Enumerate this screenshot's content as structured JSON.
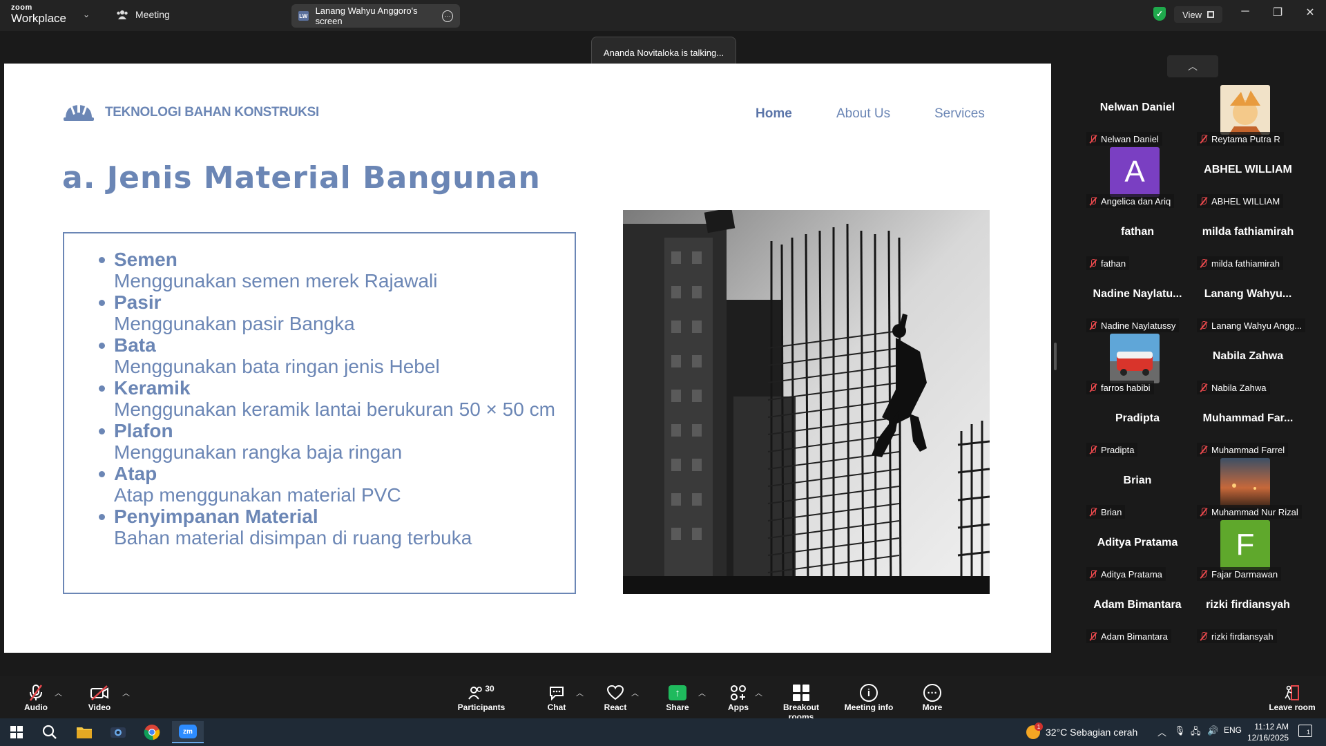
{
  "titlebar": {
    "logo_top": "zoom",
    "logo_bottom": "Workplace",
    "meeting_tab": "Meeting",
    "share_tab": "Lanang Wahyu Anggoro's screen",
    "share_badge": "LW",
    "view_label": "View"
  },
  "toast": {
    "text": "Ananda Novitaloka is talking..."
  },
  "slide": {
    "brand": "TEKNOLOGI BAHAN KONSTRUKSI",
    "nav": [
      "Home",
      "About Us",
      "Services"
    ],
    "title": "a. Jenis Material Bangunan",
    "items": [
      {
        "head": "Semen",
        "desc": "Menggunakan semen merek Rajawali"
      },
      {
        "head": "Pasir",
        "desc": "Menggunakan pasir Bangka"
      },
      {
        "head": "Bata",
        "desc": "Menggunakan bata ringan jenis Hebel"
      },
      {
        "head": "Keramik",
        "desc": "Menggunakan keramik lantai berukuran 50 × 50 cm"
      },
      {
        "head": "Plafon",
        "desc": "Menggunakan rangka baja ringan"
      },
      {
        "head": "Atap",
        "desc": "Atap menggunakan material PVC"
      },
      {
        "head": "Penyimpanan Material",
        "desc": "Bahan material disimpan di ruang terbuka"
      }
    ]
  },
  "gallery": {
    "tiles": [
      {
        "big": "Nelwan Daniel",
        "label": "Nelwan Daniel",
        "kind": "name"
      },
      {
        "big": "",
        "label": "Reytama Putra R",
        "kind": "image",
        "image": "anime-avatar"
      },
      {
        "big": "A",
        "label": "Angelica dan Ariq",
        "kind": "letter",
        "color": "#7a3fc2"
      },
      {
        "big": "ABHEL WILLIAM",
        "label": "ABHEL WILLIAM",
        "kind": "name"
      },
      {
        "big": "fathan",
        "label": "fathan",
        "kind": "name"
      },
      {
        "big": "milda fathiamirah",
        "label": "milda fathiamirah",
        "kind": "name"
      },
      {
        "big": "Nadine  Naylatu...",
        "label": "Nadine Naylatussy",
        "kind": "name"
      },
      {
        "big": "Lanang  Wahyu...",
        "label": "Lanang Wahyu Angg...",
        "kind": "name"
      },
      {
        "big": "",
        "label": "farros habibi",
        "kind": "image",
        "image": "van-avatar"
      },
      {
        "big": "Nabila Zahwa",
        "label": "Nabila Zahwa",
        "kind": "name"
      },
      {
        "big": "Pradipta",
        "label": "Pradipta",
        "kind": "name"
      },
      {
        "big": "Muhammad  Far...",
        "label": "Muhammad Farrel",
        "kind": "name"
      },
      {
        "big": "Brian",
        "label": "Brian",
        "kind": "name"
      },
      {
        "big": "",
        "label": "Muhammad Nur Rizal",
        "kind": "image",
        "image": "sunset-avatar"
      },
      {
        "big": "Aditya Pratama",
        "label": "Aditya Pratama",
        "kind": "name"
      },
      {
        "big": "F",
        "label": "Fajar Darmawan",
        "kind": "letter",
        "color": "#5fa82c"
      },
      {
        "big": "Adam Bimantara",
        "label": "Adam Bimantara",
        "kind": "name"
      },
      {
        "big": "rizki firdiansyah",
        "label": "rizki firdiansyah",
        "kind": "name"
      }
    ]
  },
  "toolbar": {
    "audio": "Audio",
    "video": "Video",
    "participants": "Participants",
    "participants_count": "30",
    "chat": "Chat",
    "react": "React",
    "share": "Share",
    "apps": "Apps",
    "breakout": "Breakout rooms",
    "info": "Meeting info",
    "more": "More",
    "leave": "Leave room"
  },
  "taskbar": {
    "weather": "32°C  Sebagian cerah",
    "lang": "ENG",
    "time": "11:12 AM",
    "date": "12/16/2025",
    "notif_count": "1"
  },
  "colors": {
    "accent": "#6b86b5",
    "share_green": "#1fba5d",
    "mute_red": "#e8484c",
    "background": "#1a1a1a"
  }
}
